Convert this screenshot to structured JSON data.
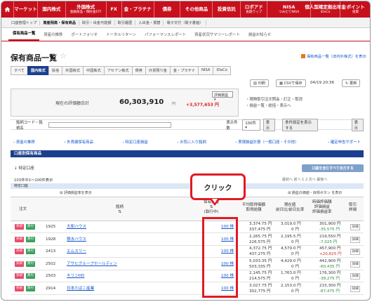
{
  "gnav": [
    {
      "label": "マーケット",
      "sub": ""
    },
    {
      "label": "国内株式",
      "sub": ""
    },
    {
      "label": "外国株式",
      "sub": "金融商品・預貯金ETF"
    },
    {
      "label": "FX",
      "sub": ""
    },
    {
      "label": "金・プラチナ",
      "sub": ""
    },
    {
      "label": "債券",
      "sub": ""
    },
    {
      "label": "その他商品",
      "sub": ""
    },
    {
      "label": "投資信託",
      "sub": ""
    },
    {
      "label": "ロボアド",
      "sub": "長期ラップ"
    },
    {
      "label": "NISA",
      "sub": "つみたてNISA"
    },
    {
      "label": "個人型確定拠出年金",
      "sub": "iDeCo"
    },
    {
      "label": "ポイント",
      "sub": "投資"
    }
  ],
  "subnav": [
    "口座管理トップ",
    "資産残高・保有商品",
    "取引・出金可能額",
    "取引履歴",
    "入出金・振替",
    "電子交付（電子書面）"
  ],
  "tabs2": [
    "保有商品一覧",
    "資産の推移",
    "ポートフォリオ",
    "トータルリターン",
    "パフォーマンスレポート",
    "資産状況サマリーレポート",
    "損益お知らせ"
  ],
  "page_title": "保有商品一覧",
  "toplink": "保有商品一覧（旧内外株式）を表示",
  "product_tabs": [
    "すべて",
    "国内株式",
    "投信",
    "外国株式",
    "中国株式",
    "アセアン株式",
    "債券",
    "外貨預り金",
    "金・プラチナ",
    "NISA",
    "iDeCo"
  ],
  "tools": {
    "print": "印刷",
    "csv": "CSVで保存",
    "refresh": "更新"
  },
  "datetime": "04/19 20:36",
  "summary": {
    "label": "現在の評価額合計",
    "value": "60,303,910",
    "unit": "円",
    "select": "評価損益",
    "diff": "+3,577,653 円"
  },
  "sideinfo": [
    "・現物取引注文照会・訂正・取消",
    "・損益一覧・総括・表示へ"
  ],
  "search": {
    "label": "銘柄コード・銘柄名",
    "count_label": "表示件数",
    "count_value": "100件",
    "btn1": "表示",
    "btn2": "条件設定を表示する",
    "btn3": "表示"
  },
  "links": [
    "資産の推移",
    "外貨建保有商品",
    "特定口座損益",
    "お気に入り銘柄",
    "実現損益計算（一般口座・その他）",
    "確定申告サポート"
  ],
  "section_title": "口座別保有商品",
  "subhead": "特定口座",
  "output_btn": "口座を含むすべて出力する",
  "count_text": "103件中1〜100件表示",
  "pager": "最初へ 前へ 1 2 次へ 最後へ",
  "account_label": "特定口座",
  "opt_left": "評価損益率を表示",
  "opt_right": "損益の価値・目標ボタン を表示",
  "headers": {
    "order": "注文",
    "name": "銘柄",
    "qty": "保有数量",
    "qty2": "(執行中)",
    "avg": "平均取得価額",
    "avg2": "取得総額",
    "price": "現在値",
    "price2": "前日比/前日比率",
    "val": "時価評価額",
    "val2": "評価損益",
    "rate": "評価損益率",
    "rate2": "取引",
    "detail": "詳細"
  },
  "rows": [
    {
      "code": "1925",
      "name": "大和ハウス",
      "qty": "100 株",
      "avg": "3,374.75 円",
      "cost": "337,475 円",
      "price": "3,019.0 円",
      "chg": "0 円",
      "val": "301,900 円",
      "pl": "-35,575 円",
      "sign": "neg"
    },
    {
      "code": "1928",
      "name": "積水ハウス",
      "qty": "100 株",
      "avg": "2,265.75 円",
      "cost": "226,575 円",
      "price": "2,195.5 円",
      "chg": "0 円",
      "val": "219,550 円",
      "pl": "-7,025 円",
      "sign": "neg"
    },
    {
      "code": "2413",
      "name": "エムスリー",
      "qty": "100 株",
      "avg": "4,372.75 円",
      "cost": "437,275 円",
      "price": "4,579.0 円",
      "chg": "0 円",
      "val": "457,900 円",
      "pl": "+20,625 円",
      "sign": "pos"
    },
    {
      "code": "2502",
      "name": "アサヒグループホールディン",
      "qty": "100 株",
      "avg": "5,033.35 円",
      "cost": "503,335 円",
      "price": "4,429.0 円",
      "chg": "0 円",
      "val": "442,900 円",
      "pl": "-60,435 円",
      "sign": "neg"
    },
    {
      "code": "2503",
      "name": "キリンHD",
      "qty": "100 株",
      "avg": "2,145.75 円",
      "cost": "214,575 円",
      "price": "1,763.0 円",
      "chg": "0 円",
      "val": "176,300 円",
      "pl": "-38,275 円",
      "sign": "neg"
    },
    {
      "code": "2914",
      "name": "日本たばこ産業",
      "qty": "100 株",
      "avg": "3,027.75 円",
      "cost": "302,775 円",
      "price": "2,153.0 円",
      "chg": "0 円",
      "val": "215,300 円",
      "pl": "-87,475 円",
      "sign": "neg"
    }
  ],
  "btn_sell": "売却",
  "btn_buy": "買付",
  "btn_detail": "詳細",
  "callout": "クリック"
}
